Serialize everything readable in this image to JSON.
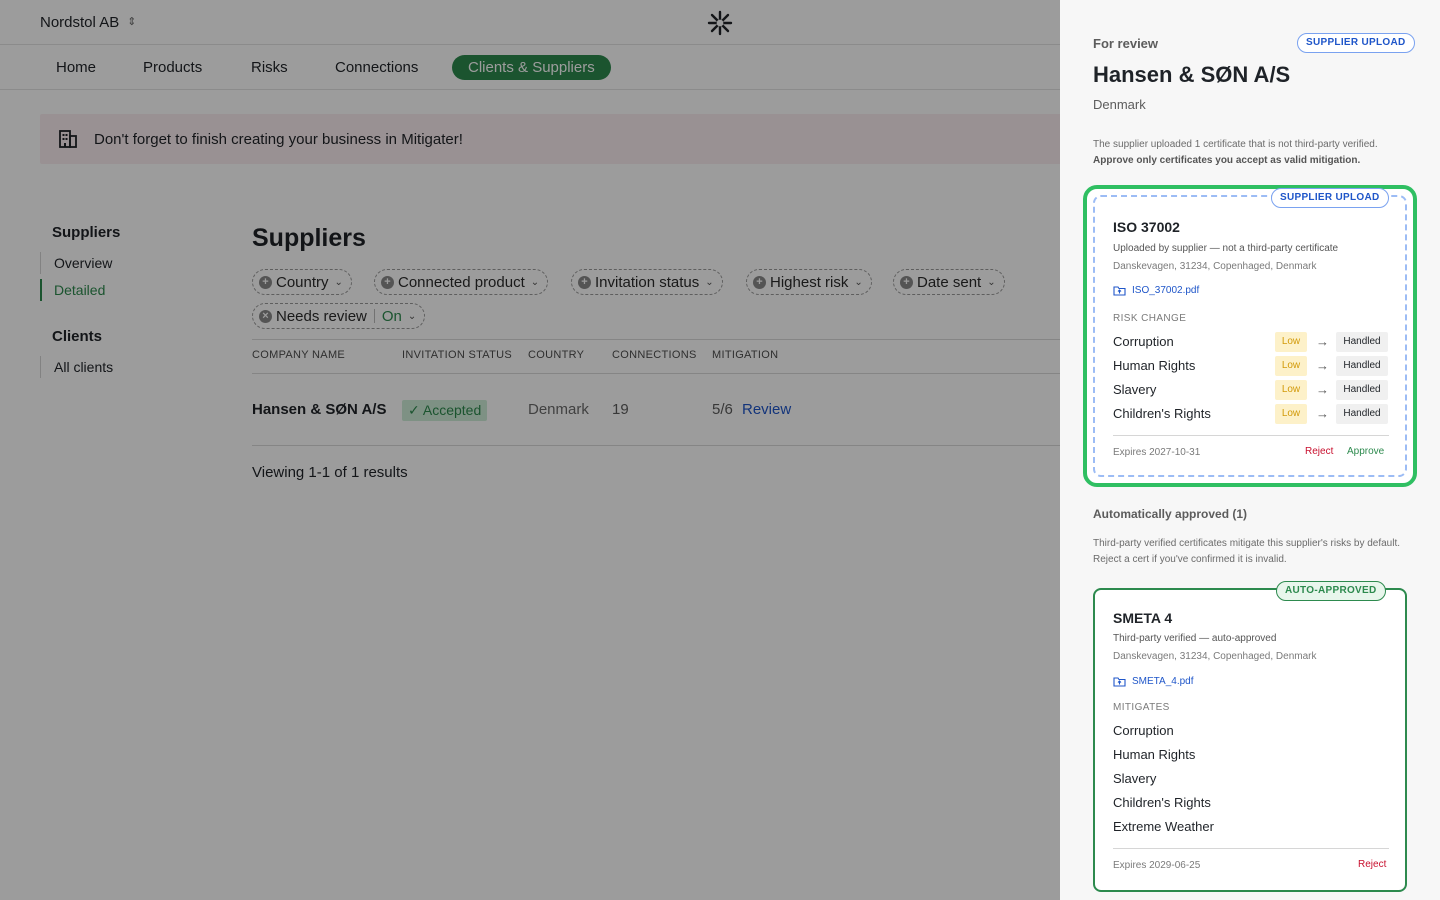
{
  "org": {
    "name": "Nordstol AB"
  },
  "nav": {
    "items": [
      {
        "label": "Home"
      },
      {
        "label": "Products"
      },
      {
        "label": "Risks"
      },
      {
        "label": "Connections"
      },
      {
        "label": "Clients & Suppliers"
      }
    ],
    "active_index": 4
  },
  "banner": {
    "text": "Don't forget to finish creating your business in Mitigater!"
  },
  "sidebar": {
    "suppliers_heading": "Suppliers",
    "suppliers_links": [
      {
        "label": "Overview"
      },
      {
        "label": "Detailed"
      }
    ],
    "clients_heading": "Clients",
    "clients_links": [
      {
        "label": "All clients"
      }
    ]
  },
  "page": {
    "title": "Suppliers"
  },
  "filters": [
    {
      "label": "Country"
    },
    {
      "label": "Connected product"
    },
    {
      "label": "Invitation status"
    },
    {
      "label": "Highest risk"
    },
    {
      "label": "Date sent"
    },
    {
      "label": "Needs review",
      "value": "On"
    }
  ],
  "table": {
    "headers": [
      "COMPANY NAME",
      "INVITATION STATUS",
      "COUNTRY",
      "CONNECTIONS",
      "MITIGATION"
    ],
    "rows": [
      {
        "company": "Hansen & SØN A/S",
        "status": "Accepted",
        "country": "Denmark",
        "connections": "19",
        "mitigation": "5/6",
        "action": "Review"
      }
    ],
    "footer": "Viewing 1-1 of 1 results"
  },
  "panel": {
    "for_review": "For review",
    "header_tag": "SUPPLIER UPLOAD",
    "supplier_name": "Hansen & SØN A/S",
    "country": "Denmark",
    "notice_line1": "The supplier uploaded 1 certificate that is not third-party verified.",
    "notice_line2": "Approve only certificates you accept as valid mitigation.",
    "review_card": {
      "tag": "SUPPLIER UPLOAD",
      "title": "ISO 37002",
      "subtitle": "Uploaded by supplier — not a third-party certificate",
      "address": "Danskevagen, 31234, Copenhaged, Denmark",
      "file": "ISO_37002.pdf",
      "section_label": "RISK CHANGE",
      "risks": [
        {
          "name": "Corruption",
          "from": "Low",
          "to": "Handled"
        },
        {
          "name": "Human Rights",
          "from": "Low",
          "to": "Handled"
        },
        {
          "name": "Slavery",
          "from": "Low",
          "to": "Handled"
        },
        {
          "name": "Children's Rights",
          "from": "Low",
          "to": "Handled"
        }
      ],
      "expires": "Expires 2027-10-31",
      "reject_label": "Reject",
      "approve_label": "Approve"
    },
    "auto_heading": "Automatically approved (1)",
    "auto_note": "Third-party verified certificates mitigate this supplier's risks by default. Reject a cert if you've confirmed it is invalid.",
    "auto_card": {
      "tag": "AUTO-APPROVED",
      "title": "SMETA 4",
      "subtitle": "Third-party verified — auto-approved",
      "address": "Danskevagen, 31234, Copenhaged, Denmark",
      "file": "SMETA_4.pdf",
      "section_label": "MITIGATES",
      "mitigates": [
        "Corruption",
        "Human Rights",
        "Slavery",
        "Children's Rights",
        "Extreme Weather"
      ],
      "expires": "Expires 2029-06-25",
      "reject_label": "Reject"
    }
  },
  "colors": {
    "accent_green": "#2d8a4e",
    "highlight_green": "#2fbf62",
    "link_blue": "#1f56c9",
    "reject_red": "#c8102e",
    "low_amber": "#d29a0a"
  }
}
